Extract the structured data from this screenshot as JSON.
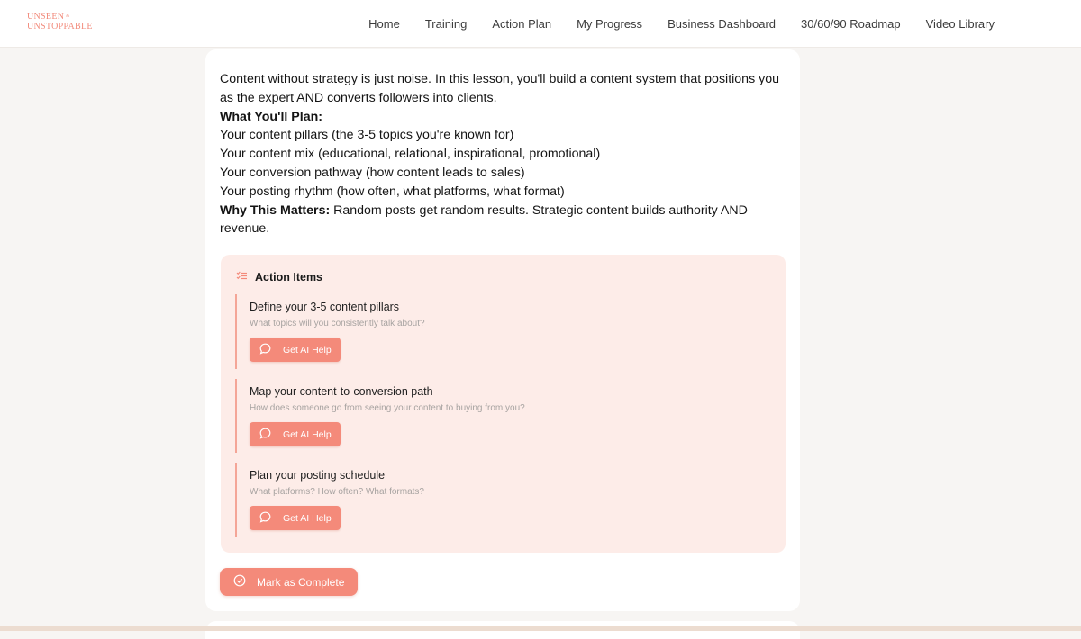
{
  "brand": {
    "line1": "UNSEEN",
    "amp": "&",
    "line2": "UNSTOPPABLE"
  },
  "nav": [
    {
      "label": "Home"
    },
    {
      "label": "Training"
    },
    {
      "label": "Action Plan"
    },
    {
      "label": "My Progress"
    },
    {
      "label": "Business Dashboard"
    },
    {
      "label": "30/60/90 Roadmap"
    },
    {
      "label": "Video Library"
    }
  ],
  "lesson": {
    "intro": "Content without strategy is just noise. In this lesson, you'll build a content system that positions you as the expert AND converts followers into clients.",
    "plan_heading": "What You'll Plan:",
    "plan_items": [
      "Your content pillars (the 3-5 topics you're known for)",
      "Your content mix (educational, relational, inspirational, promotional)",
      "Your conversion pathway (how content leads to sales)",
      "Your posting rhythm (how often, what platforms, what format)"
    ],
    "why_label": "Why This Matters:",
    "why_text": " Random posts get random results. Strategic content builds authority AND revenue."
  },
  "action_items": {
    "heading": "Action Items",
    "icon": "checklist-icon",
    "items": [
      {
        "title": "Define your 3-5 content pillars",
        "description": "What topics will you consistently talk about?",
        "button": "Get AI Help"
      },
      {
        "title": "Map your content-to-conversion path",
        "description": "How does someone go from seeing your content to buying from you?",
        "button": "Get AI Help"
      },
      {
        "title": "Plan your posting schedule",
        "description": "What platforms? How often? What formats?",
        "button": "Get AI Help"
      }
    ]
  },
  "complete_button": "Mark as Complete",
  "colors": {
    "accent": "#f48a7a",
    "action_bg": "#fdece8",
    "page_bg": "#f7f5f3"
  }
}
